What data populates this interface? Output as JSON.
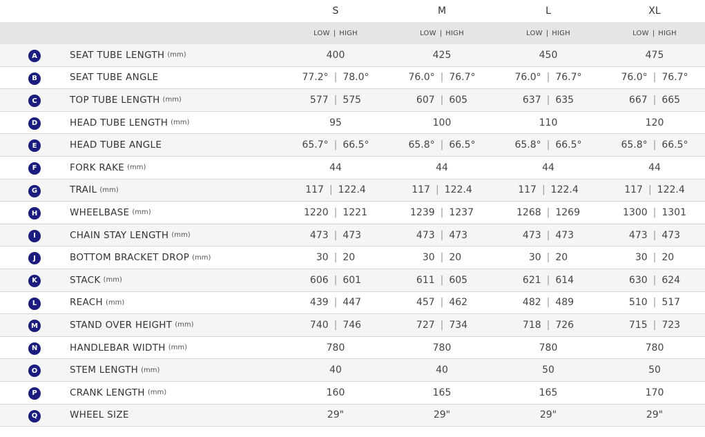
{
  "sizes": [
    "S",
    "M",
    "L",
    "XL"
  ],
  "low_label": "LOW",
  "high_label": "HIGH",
  "rows": [
    {
      "letter": "A",
      "name": "SEAT TUBE LENGTH",
      "unit": "(mm)",
      "values": [
        [
          "400"
        ],
        [
          "425"
        ],
        [
          "450"
        ],
        [
          "475"
        ]
      ]
    },
    {
      "letter": "B",
      "name": "SEAT TUBE ANGLE",
      "unit": "",
      "values": [
        [
          "77.2°",
          "78.0°"
        ],
        [
          "76.0°",
          "76.7°"
        ],
        [
          "76.0°",
          "76.7°"
        ],
        [
          "76.0°",
          "76.7°"
        ]
      ]
    },
    {
      "letter": "C",
      "name": "TOP TUBE LENGTH",
      "unit": "(mm)",
      "values": [
        [
          "577",
          "575"
        ],
        [
          "607",
          "605"
        ],
        [
          "637",
          "635"
        ],
        [
          "667",
          "665"
        ]
      ]
    },
    {
      "letter": "D",
      "name": "HEAD TUBE LENGTH",
      "unit": "(mm)",
      "values": [
        [
          "95"
        ],
        [
          "100"
        ],
        [
          "110"
        ],
        [
          "120"
        ]
      ]
    },
    {
      "letter": "E",
      "name": "HEAD TUBE ANGLE",
      "unit": "",
      "values": [
        [
          "65.7°",
          "66.5°"
        ],
        [
          "65.8°",
          "66.5°"
        ],
        [
          "65.8°",
          "66.5°"
        ],
        [
          "65.8°",
          "66.5°"
        ]
      ]
    },
    {
      "letter": "F",
      "name": "FORK RAKE",
      "unit": "(mm)",
      "values": [
        [
          "44"
        ],
        [
          "44"
        ],
        [
          "44"
        ],
        [
          "44"
        ]
      ]
    },
    {
      "letter": "G",
      "name": "TRAIL",
      "unit": "(mm)",
      "values": [
        [
          "117",
          "122.4"
        ],
        [
          "117",
          "122.4"
        ],
        [
          "117",
          "122.4"
        ],
        [
          "117",
          "122.4"
        ]
      ]
    },
    {
      "letter": "H",
      "name": "WHEELBASE",
      "unit": "(mm)",
      "values": [
        [
          "1220",
          "1221"
        ],
        [
          "1239",
          "1237"
        ],
        [
          "1268",
          "1269"
        ],
        [
          "1300",
          "1301"
        ]
      ]
    },
    {
      "letter": "I",
      "name": "CHAIN STAY LENGTH",
      "unit": "(mm)",
      "values": [
        [
          "473",
          "473"
        ],
        [
          "473",
          "473"
        ],
        [
          "473",
          "473"
        ],
        [
          "473",
          "473"
        ]
      ]
    },
    {
      "letter": "J",
      "name": "BOTTOM BRACKET DROP",
      "unit": "(mm)",
      "values": [
        [
          "30",
          "20"
        ],
        [
          "30",
          "20"
        ],
        [
          "30",
          "20"
        ],
        [
          "30",
          "20"
        ]
      ]
    },
    {
      "letter": "K",
      "name": "STACK",
      "unit": "(mm)",
      "values": [
        [
          "606",
          "601"
        ],
        [
          "611",
          "605"
        ],
        [
          "621",
          "614"
        ],
        [
          "630",
          "624"
        ]
      ]
    },
    {
      "letter": "L",
      "name": "REACH",
      "unit": "(mm)",
      "values": [
        [
          "439",
          "447"
        ],
        [
          "457",
          "462"
        ],
        [
          "482",
          "489"
        ],
        [
          "510",
          "517"
        ]
      ]
    },
    {
      "letter": "M",
      "name": "STAND OVER HEIGHT",
      "unit": "(mm)",
      "values": [
        [
          "740",
          "746"
        ],
        [
          "727",
          "734"
        ],
        [
          "718",
          "726"
        ],
        [
          "715",
          "723"
        ]
      ]
    },
    {
      "letter": "N",
      "name": "HANDLEBAR WIDTH",
      "unit": "(mm)",
      "values": [
        [
          "780"
        ],
        [
          "780"
        ],
        [
          "780"
        ],
        [
          "780"
        ]
      ]
    },
    {
      "letter": "O",
      "name": "STEM LENGTH",
      "unit": "(mm)",
      "values": [
        [
          "40"
        ],
        [
          "40"
        ],
        [
          "50"
        ],
        [
          "50"
        ]
      ]
    },
    {
      "letter": "P",
      "name": "CRANK LENGTH",
      "unit": "(mm)",
      "values": [
        [
          "160"
        ],
        [
          "165"
        ],
        [
          "165"
        ],
        [
          "170"
        ]
      ]
    },
    {
      "letter": "Q",
      "name": "WHEEL SIZE",
      "unit": "",
      "values": [
        [
          "29\""
        ],
        [
          "29\""
        ],
        [
          "29\""
        ],
        [
          "29\""
        ]
      ]
    }
  ]
}
